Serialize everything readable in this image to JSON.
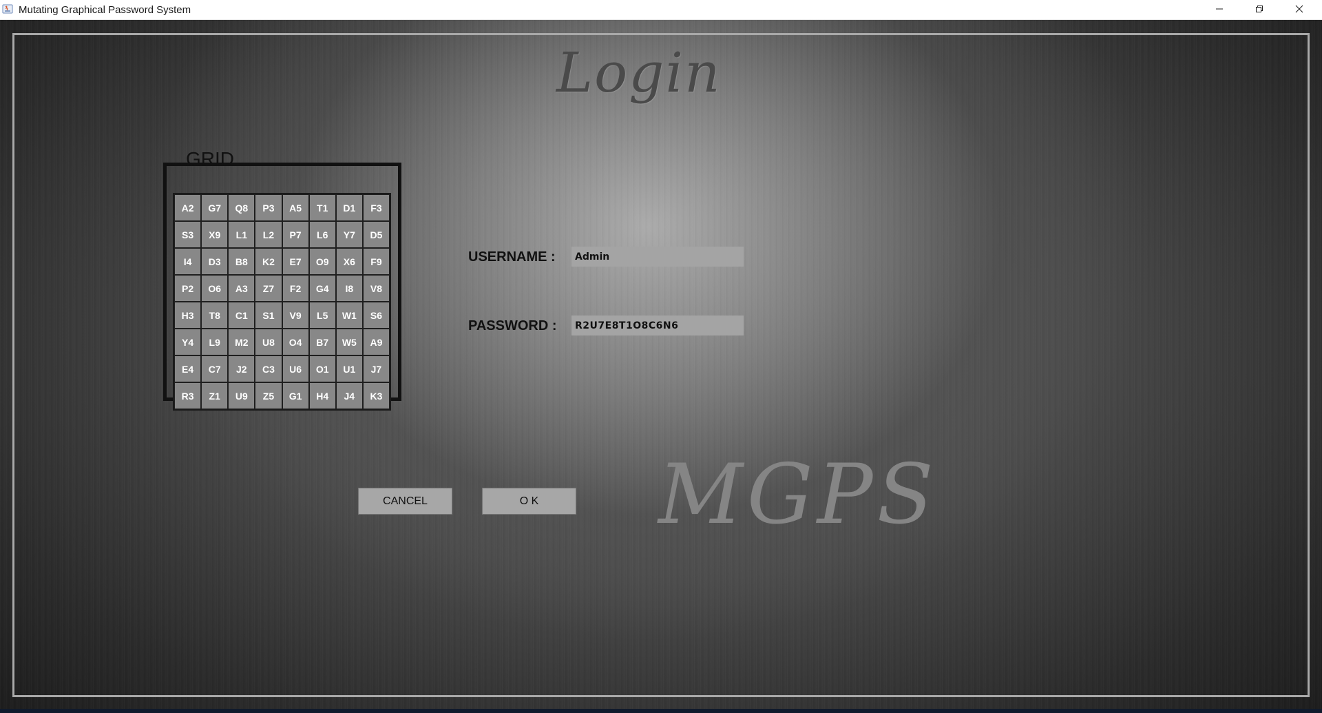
{
  "window": {
    "title": "Mutating Graphical Password System"
  },
  "window_controls": {
    "icons": [
      "minimize-icon",
      "restore-icon",
      "close-icon"
    ]
  },
  "login": {
    "heading": "Login",
    "brand": "MGPS"
  },
  "grid": {
    "legend": "GRID",
    "rows": [
      [
        "A2",
        "G7",
        "Q8",
        "P3",
        "A5",
        "T1",
        "D1",
        "F3"
      ],
      [
        "S3",
        "X9",
        "L1",
        "L2",
        "P7",
        "L6",
        "Y7",
        "D5"
      ],
      [
        "I4",
        "D3",
        "B8",
        "K2",
        "E7",
        "O9",
        "X6",
        "F9"
      ],
      [
        "P2",
        "O6",
        "A3",
        "Z7",
        "F2",
        "G4",
        "I8",
        "V8"
      ],
      [
        "H3",
        "T8",
        "C1",
        "S1",
        "V9",
        "L5",
        "W1",
        "S6"
      ],
      [
        "Y4",
        "L9",
        "M2",
        "U8",
        "O4",
        "B7",
        "W5",
        "A9"
      ],
      [
        "E4",
        "C7",
        "J2",
        "C3",
        "U6",
        "O1",
        "U1",
        "J7"
      ],
      [
        "R3",
        "Z1",
        "U9",
        "Z5",
        "G1",
        "H4",
        "J4",
        "K3"
      ]
    ]
  },
  "form": {
    "username_label": "USERNAME :",
    "username_value": "Admin",
    "password_label": "PASSWORD :",
    "password_value": "R2U7E8T1O8C6N6"
  },
  "buttons": {
    "cancel": "CANCEL",
    "ok": "O K"
  },
  "colors": {
    "background_center": "#afafaf",
    "background_edge": "#1c1c1c",
    "cell": "#888888",
    "input": "#a4a4a4",
    "button": "#a7a7a7"
  }
}
